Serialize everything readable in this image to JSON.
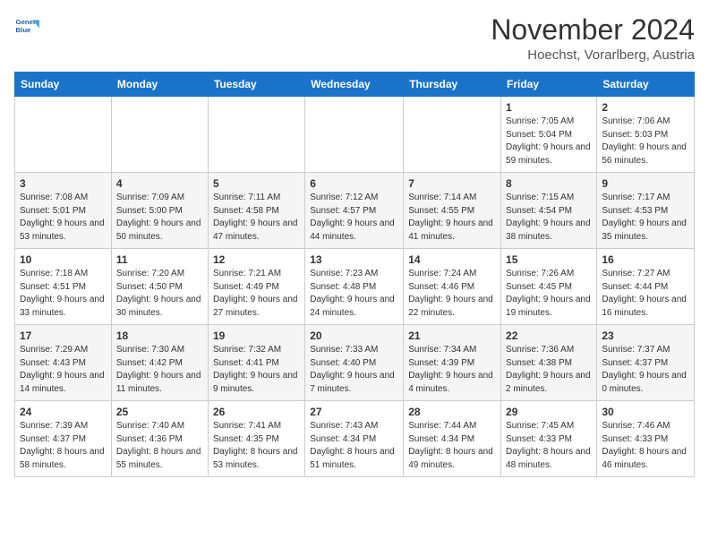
{
  "header": {
    "logo_line1": "General",
    "logo_line2": "Blue",
    "month": "November 2024",
    "location": "Hoechst, Vorarlberg, Austria"
  },
  "weekdays": [
    "Sunday",
    "Monday",
    "Tuesday",
    "Wednesday",
    "Thursday",
    "Friday",
    "Saturday"
  ],
  "weeks": [
    [
      {
        "day": "",
        "info": ""
      },
      {
        "day": "",
        "info": ""
      },
      {
        "day": "",
        "info": ""
      },
      {
        "day": "",
        "info": ""
      },
      {
        "day": "",
        "info": ""
      },
      {
        "day": "1",
        "info": "Sunrise: 7:05 AM\nSunset: 5:04 PM\nDaylight: 9 hours and 59 minutes."
      },
      {
        "day": "2",
        "info": "Sunrise: 7:06 AM\nSunset: 5:03 PM\nDaylight: 9 hours and 56 minutes."
      }
    ],
    [
      {
        "day": "3",
        "info": "Sunrise: 7:08 AM\nSunset: 5:01 PM\nDaylight: 9 hours and 53 minutes."
      },
      {
        "day": "4",
        "info": "Sunrise: 7:09 AM\nSunset: 5:00 PM\nDaylight: 9 hours and 50 minutes."
      },
      {
        "day": "5",
        "info": "Sunrise: 7:11 AM\nSunset: 4:58 PM\nDaylight: 9 hours and 47 minutes."
      },
      {
        "day": "6",
        "info": "Sunrise: 7:12 AM\nSunset: 4:57 PM\nDaylight: 9 hours and 44 minutes."
      },
      {
        "day": "7",
        "info": "Sunrise: 7:14 AM\nSunset: 4:55 PM\nDaylight: 9 hours and 41 minutes."
      },
      {
        "day": "8",
        "info": "Sunrise: 7:15 AM\nSunset: 4:54 PM\nDaylight: 9 hours and 38 minutes."
      },
      {
        "day": "9",
        "info": "Sunrise: 7:17 AM\nSunset: 4:53 PM\nDaylight: 9 hours and 35 minutes."
      }
    ],
    [
      {
        "day": "10",
        "info": "Sunrise: 7:18 AM\nSunset: 4:51 PM\nDaylight: 9 hours and 33 minutes."
      },
      {
        "day": "11",
        "info": "Sunrise: 7:20 AM\nSunset: 4:50 PM\nDaylight: 9 hours and 30 minutes."
      },
      {
        "day": "12",
        "info": "Sunrise: 7:21 AM\nSunset: 4:49 PM\nDaylight: 9 hours and 27 minutes."
      },
      {
        "day": "13",
        "info": "Sunrise: 7:23 AM\nSunset: 4:48 PM\nDaylight: 9 hours and 24 minutes."
      },
      {
        "day": "14",
        "info": "Sunrise: 7:24 AM\nSunset: 4:46 PM\nDaylight: 9 hours and 22 minutes."
      },
      {
        "day": "15",
        "info": "Sunrise: 7:26 AM\nSunset: 4:45 PM\nDaylight: 9 hours and 19 minutes."
      },
      {
        "day": "16",
        "info": "Sunrise: 7:27 AM\nSunset: 4:44 PM\nDaylight: 9 hours and 16 minutes."
      }
    ],
    [
      {
        "day": "17",
        "info": "Sunrise: 7:29 AM\nSunset: 4:43 PM\nDaylight: 9 hours and 14 minutes."
      },
      {
        "day": "18",
        "info": "Sunrise: 7:30 AM\nSunset: 4:42 PM\nDaylight: 9 hours and 11 minutes."
      },
      {
        "day": "19",
        "info": "Sunrise: 7:32 AM\nSunset: 4:41 PM\nDaylight: 9 hours and 9 minutes."
      },
      {
        "day": "20",
        "info": "Sunrise: 7:33 AM\nSunset: 4:40 PM\nDaylight: 9 hours and 7 minutes."
      },
      {
        "day": "21",
        "info": "Sunrise: 7:34 AM\nSunset: 4:39 PM\nDaylight: 9 hours and 4 minutes."
      },
      {
        "day": "22",
        "info": "Sunrise: 7:36 AM\nSunset: 4:38 PM\nDaylight: 9 hours and 2 minutes."
      },
      {
        "day": "23",
        "info": "Sunrise: 7:37 AM\nSunset: 4:37 PM\nDaylight: 9 hours and 0 minutes."
      }
    ],
    [
      {
        "day": "24",
        "info": "Sunrise: 7:39 AM\nSunset: 4:37 PM\nDaylight: 8 hours and 58 minutes."
      },
      {
        "day": "25",
        "info": "Sunrise: 7:40 AM\nSunset: 4:36 PM\nDaylight: 8 hours and 55 minutes."
      },
      {
        "day": "26",
        "info": "Sunrise: 7:41 AM\nSunset: 4:35 PM\nDaylight: 8 hours and 53 minutes."
      },
      {
        "day": "27",
        "info": "Sunrise: 7:43 AM\nSunset: 4:34 PM\nDaylight: 8 hours and 51 minutes."
      },
      {
        "day": "28",
        "info": "Sunrise: 7:44 AM\nSunset: 4:34 PM\nDaylight: 8 hours and 49 minutes."
      },
      {
        "day": "29",
        "info": "Sunrise: 7:45 AM\nSunset: 4:33 PM\nDaylight: 8 hours and 48 minutes."
      },
      {
        "day": "30",
        "info": "Sunrise: 7:46 AM\nSunset: 4:33 PM\nDaylight: 8 hours and 46 minutes."
      }
    ]
  ]
}
